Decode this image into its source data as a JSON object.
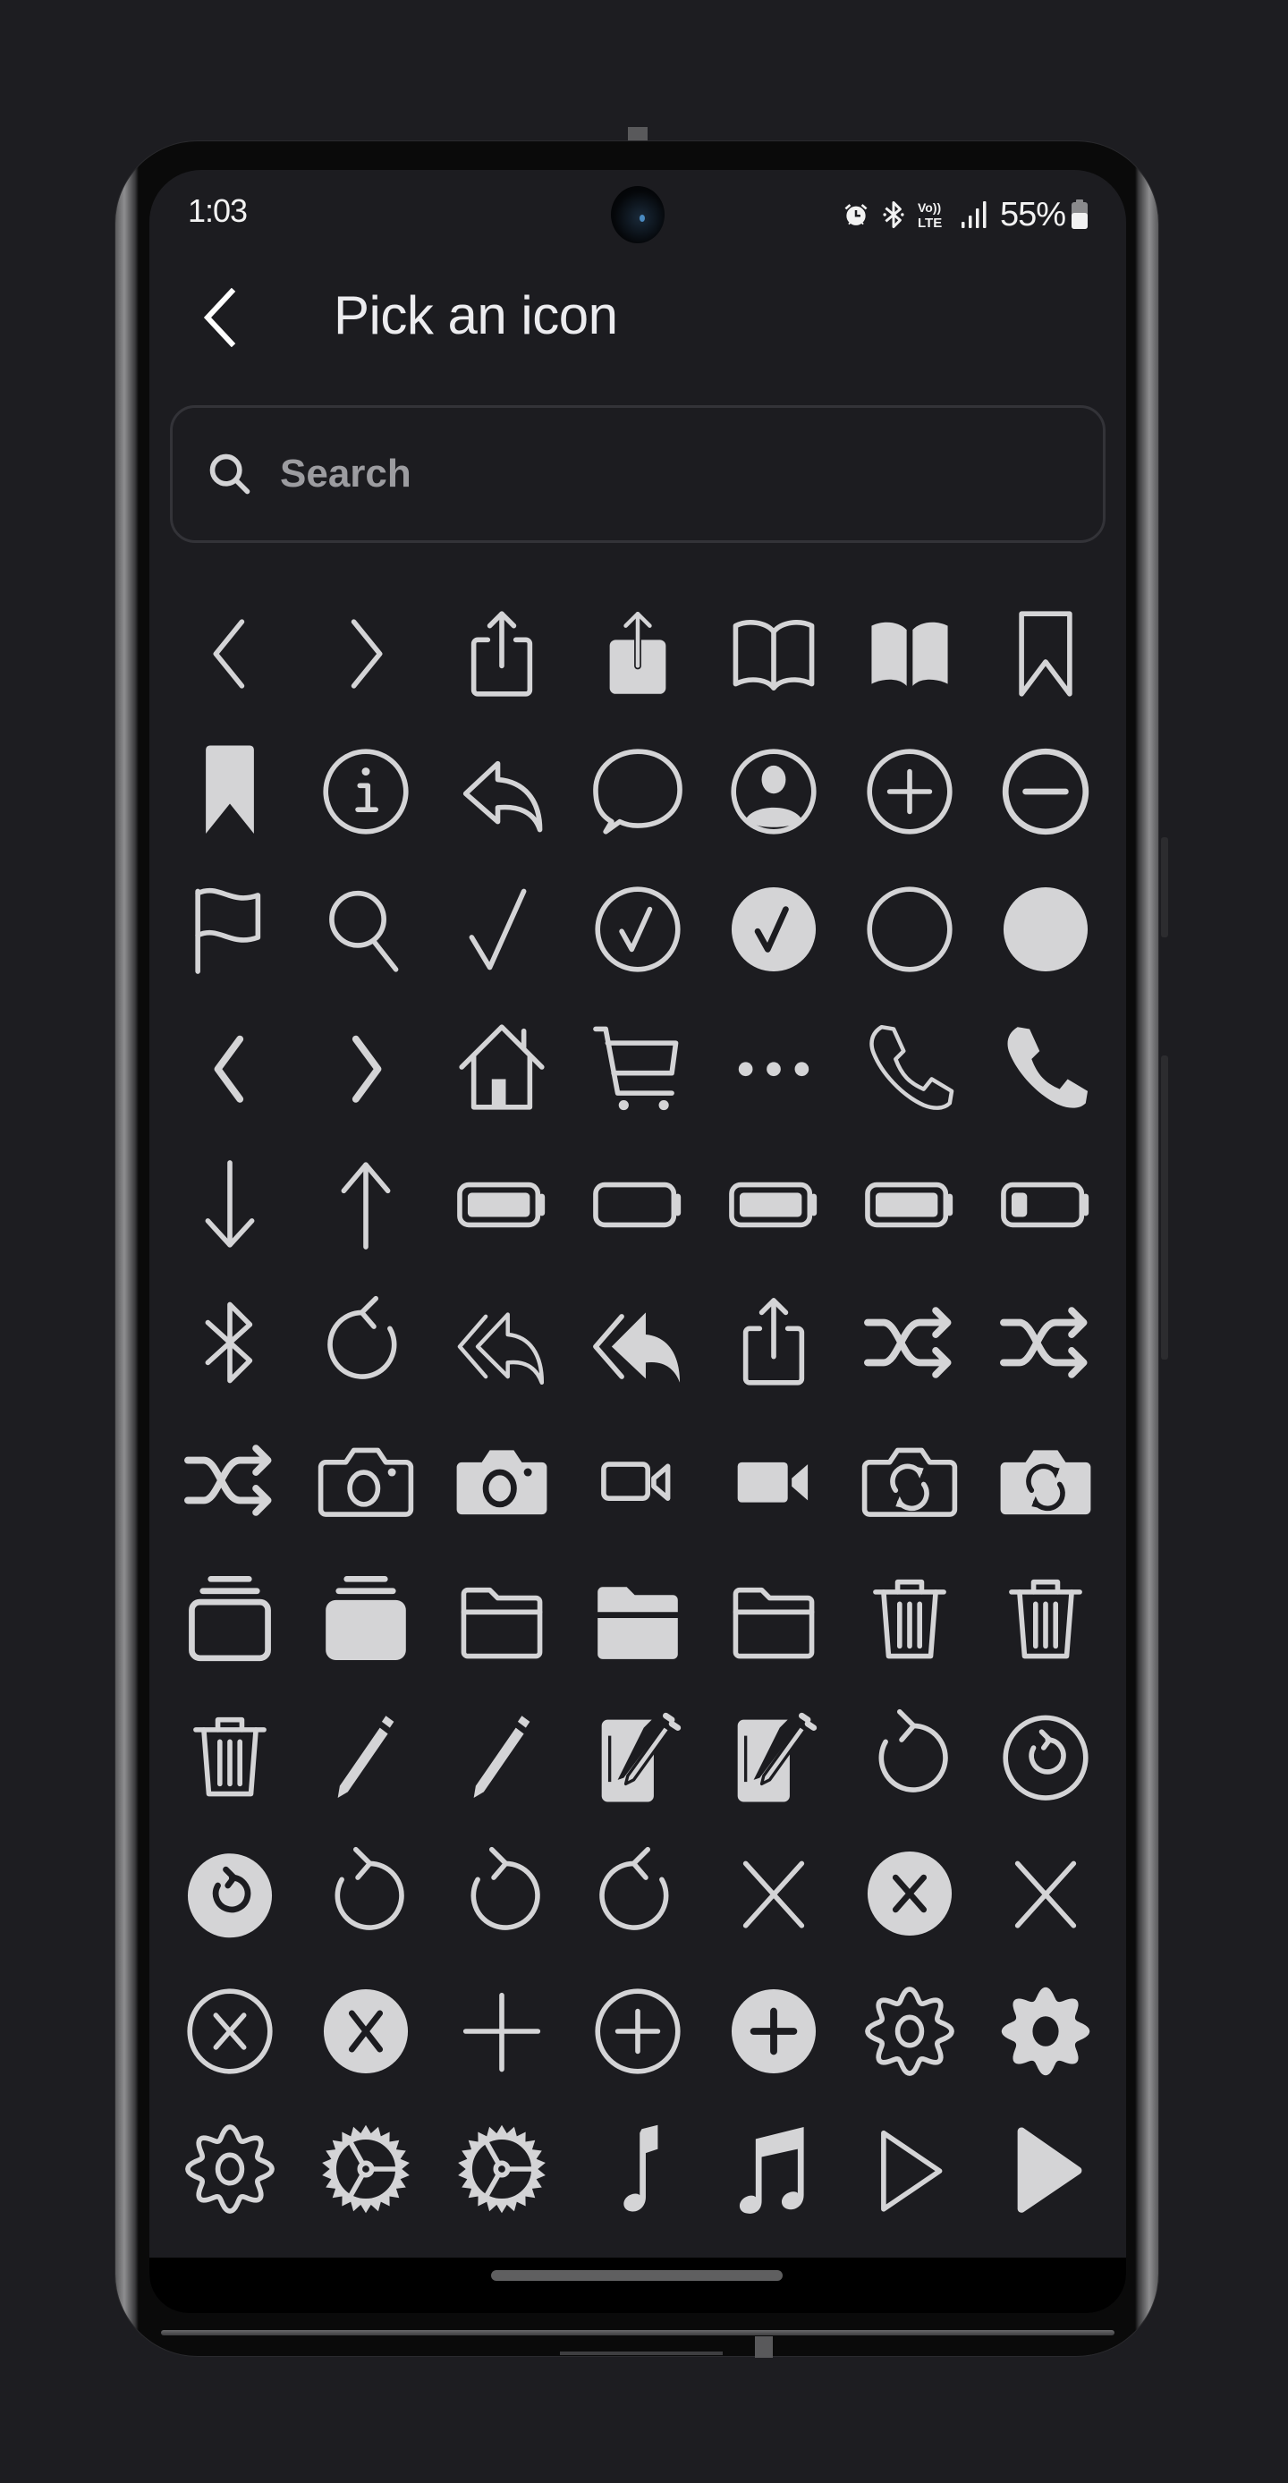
{
  "status_bar": {
    "time": "1:03",
    "icons": [
      "alarm-icon",
      "bluetooth-icon",
      "volte-icon",
      "signal-icon"
    ],
    "battery_percent": "55%"
  },
  "app_bar": {
    "back_icon": "back-chevron-icon",
    "title": "Pick an icon"
  },
  "search": {
    "value": "",
    "placeholder": "Search",
    "icon": "search-icon"
  },
  "colors": {
    "background": "#1c1c20",
    "icon": "#d4d4d6",
    "title": "#ececef",
    "placeholder": "#9c9ca0",
    "search_border": "#333338"
  },
  "icons": [
    "chevron-left",
    "chevron-right",
    "share",
    "share-fill",
    "book",
    "book-fill",
    "bookmark",
    "bookmark-fill",
    "info-circle",
    "reply",
    "chat-bubble",
    "person-circle",
    "plus-circle",
    "minus-circle",
    "flag",
    "magnifying-glass",
    "checkmark",
    "checkmark-circle",
    "checkmark-circle-fill",
    "circle",
    "circle-fill",
    "chevron-left-bold",
    "chevron-right-bold",
    "house",
    "cart",
    "ellipsis",
    "phone",
    "phone-fill",
    "arrow-down",
    "arrow-up",
    "battery-100",
    "battery-0",
    "battery-75",
    "battery-50",
    "battery-25",
    "bluetooth",
    "arrow-counterclockwise",
    "reply-all",
    "reply-all-fill",
    "share-bold",
    "shuffle",
    "shuffle-alt",
    "shuffle-bold",
    "camera",
    "camera-fill",
    "video",
    "video-fill",
    "camera-rotate",
    "camera-rotate-fill",
    "rectangle-stack",
    "rectangle-stack-fill",
    "folder",
    "folder-fill",
    "folder-alt",
    "trash",
    "trash-alt",
    "trash-bold",
    "pencil",
    "pencil-alt",
    "square-pencil",
    "square-pencil-alt",
    "arrow-clockwise",
    "arrow-clockwise-circle",
    "arrow-clockwise-circle-fill",
    "arrow-clockwise-alt",
    "arrow-clockwise-bold",
    "arrow-counterclockwise-bold",
    "xmark",
    "xmark-circle-fill",
    "xmark-alt",
    "xmark-circle",
    "xmark-circle-fill-alt",
    "plus",
    "plus-circle-alt",
    "plus-circle-fill",
    "gear",
    "gear-fill",
    "gear-alt",
    "gearshape",
    "gearshape-alt",
    "music-note",
    "music-notes",
    "play",
    "play-fill"
  ]
}
